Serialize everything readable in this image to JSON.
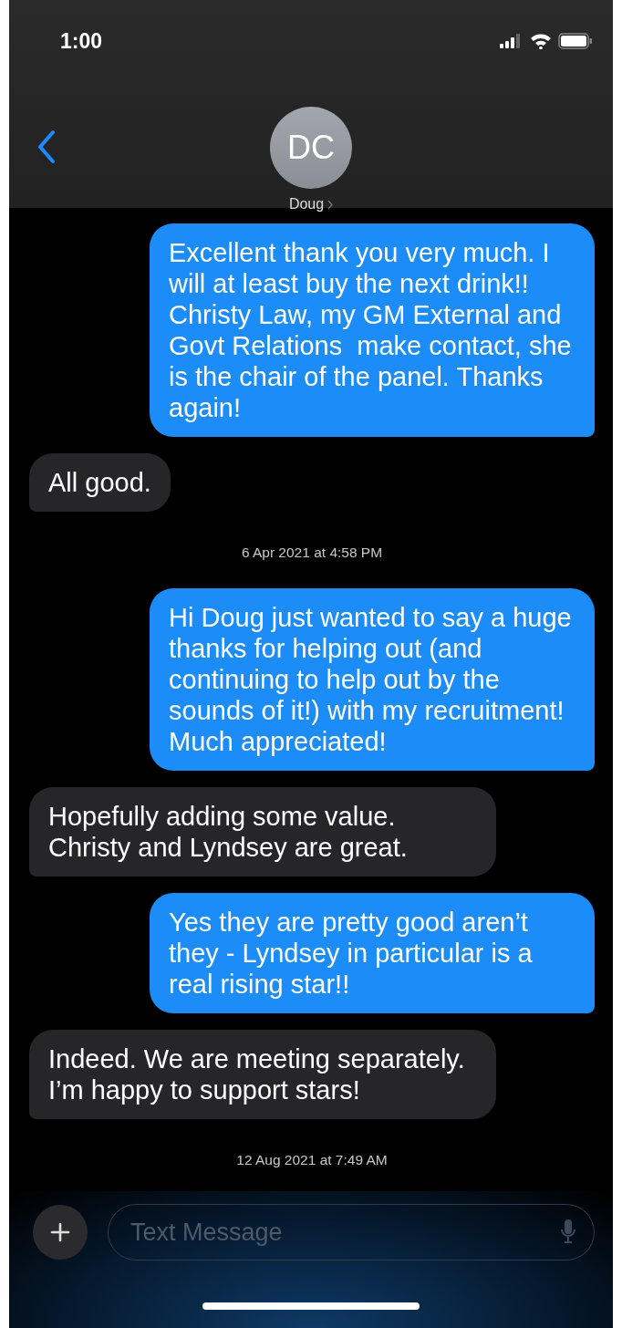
{
  "status_bar": {
    "time": "1:00"
  },
  "contact": {
    "initials": "DC",
    "name": "Doug"
  },
  "messages": [
    {
      "kind": "sent",
      "text": "Excellent thank you very much. I will at least buy the next drink!! Christy Law, my GM External and Govt Relations  make contact, she is the chair of the panel. Thanks again!"
    },
    {
      "kind": "received",
      "text": "All good."
    },
    {
      "kind": "timestamp",
      "text": "6 Apr 2021 at 4:58 PM"
    },
    {
      "kind": "sent",
      "text": "Hi Doug just wanted to say a huge thanks for helping out (and continuing to help out by the sounds of it!) with my recruitment! Much appreciated!"
    },
    {
      "kind": "received",
      "text": "Hopefully adding some value. Christy and Lyndsey are great."
    },
    {
      "kind": "sent",
      "text": "Yes they are pretty good aren’t they - Lyndsey in particular is a real rising star!!"
    },
    {
      "kind": "received",
      "text": "Indeed. We are meeting separately. I’m happy to support stars!"
    },
    {
      "kind": "timestamp",
      "text": "12 Aug 2021 at 7:49 AM"
    }
  ],
  "composer": {
    "placeholder": "Text Message"
  }
}
